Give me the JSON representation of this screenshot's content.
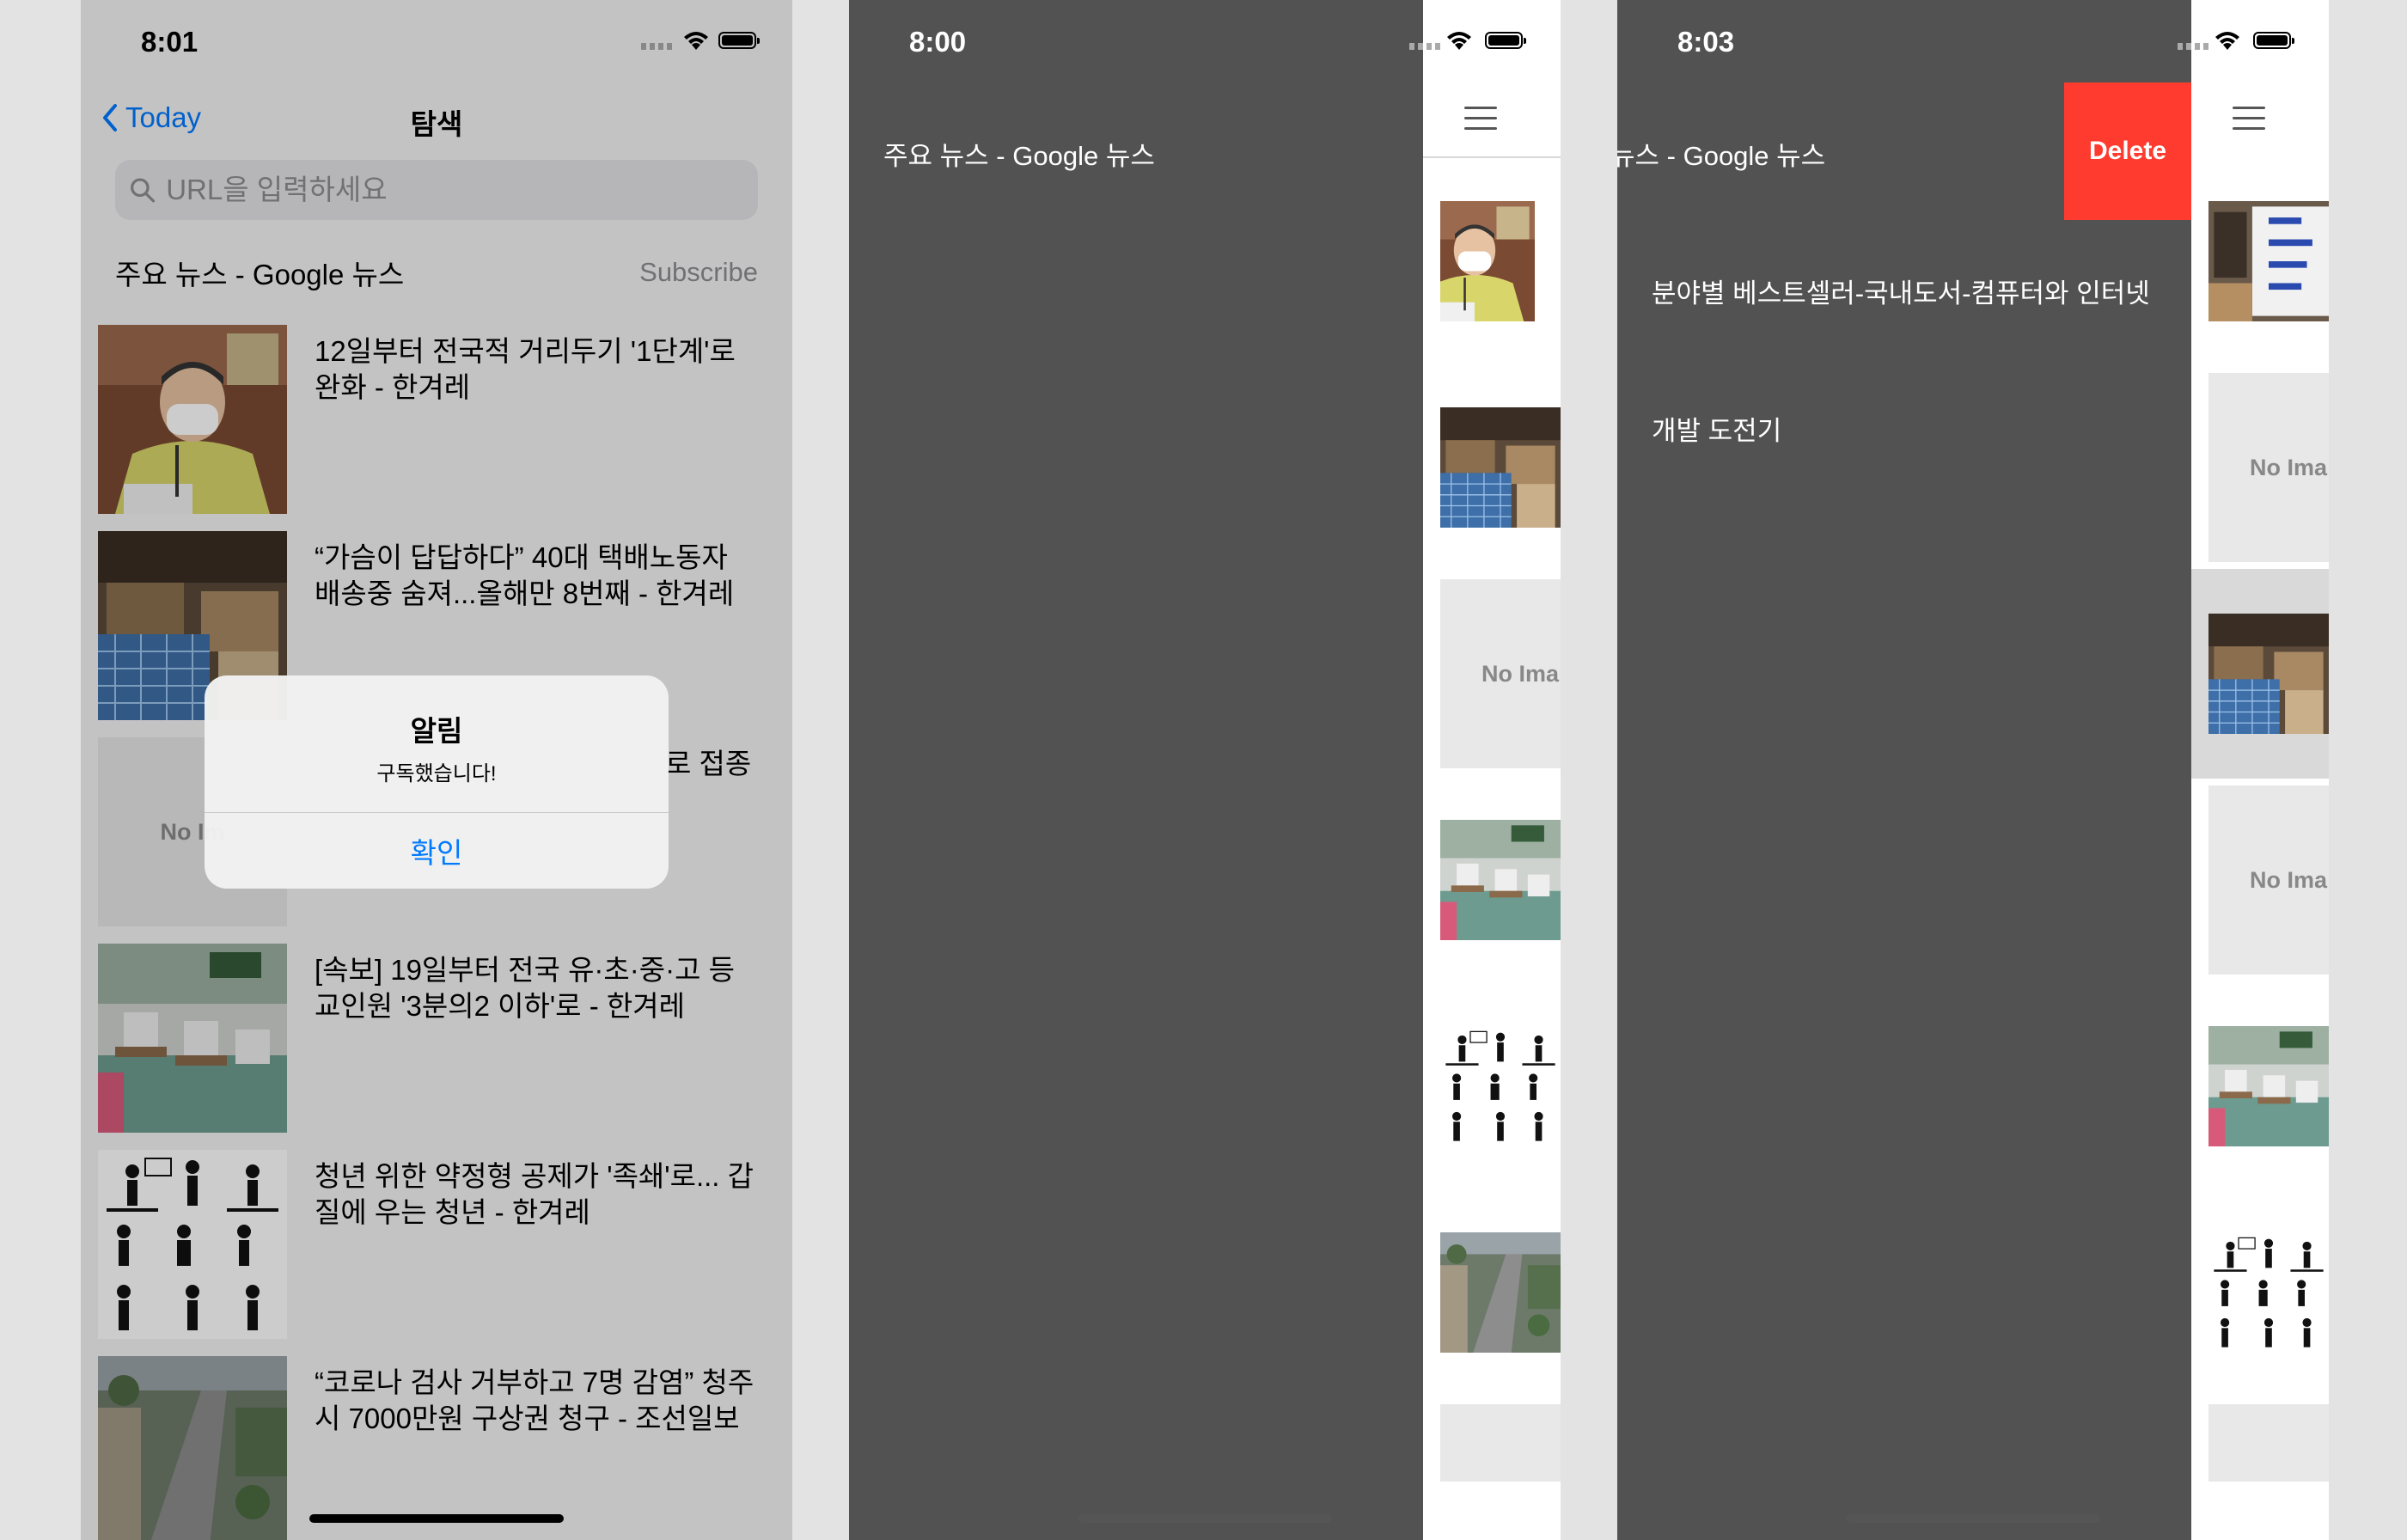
{
  "phone1": {
    "time": "8:01",
    "back_label": "Today",
    "title": "탐색",
    "search_placeholder": "URL을 입력하세요",
    "subscription": {
      "title": "주요 뉴스 - Google 뉴스",
      "button": "Subscribe"
    },
    "news": [
      {
        "headline": "12일부터 전국적 거리두기 '1단계'로 완화 - 한겨레",
        "image": "mask-official"
      },
      {
        "headline": "“가슴이 답답하다” 40대 택배노동자 배송중 숨져...올해만 8번째 - 한겨레",
        "image": "parcel-carts"
      },
      {
        "headline": "로 접종",
        "image": "none",
        "no_image_label": "No Im"
      },
      {
        "headline": "[속보] 19일부터 전국 유·초·중·고 등교인원 '3분의2 이하'로 - 한겨레",
        "image": "classroom"
      },
      {
        "headline": "청년 위한 약정형 공제가 '족쇄'로... 갑질에 우는 청년 - 한겨레",
        "image": "pictograms"
      },
      {
        "headline": "“코로나 검사 거부하고 7명 감염” 청주시 7000만원 구상권 청구 - 조선일보",
        "image": "aerial-road"
      }
    ],
    "alert": {
      "title": "알림",
      "message": "구독했습니다!",
      "button": "확인"
    }
  },
  "phone2": {
    "time": "8:00",
    "menu": [
      "주요 뉴스 - Google 뉴스"
    ],
    "peek_thumbs": [
      "mask-official",
      "parcel-carts",
      "No Ima",
      "classroom",
      "pictograms",
      "aerial-road"
    ]
  },
  "phone3": {
    "time": "8:03",
    "menu": [
      "뉴스 - Google 뉴스",
      "분야별 베스트셀러-국내도서-컴퓨터와 인터넷",
      "개발 도전기"
    ],
    "delete_label": "Delete",
    "peek_thumbs": [
      "sign-board",
      "No Ima",
      "parcel-carts",
      "No Ima",
      "classroom",
      "pictograms"
    ]
  },
  "colors": {
    "accent": "#007aff",
    "drawer": "#525252",
    "delete": "#ff3b30"
  }
}
